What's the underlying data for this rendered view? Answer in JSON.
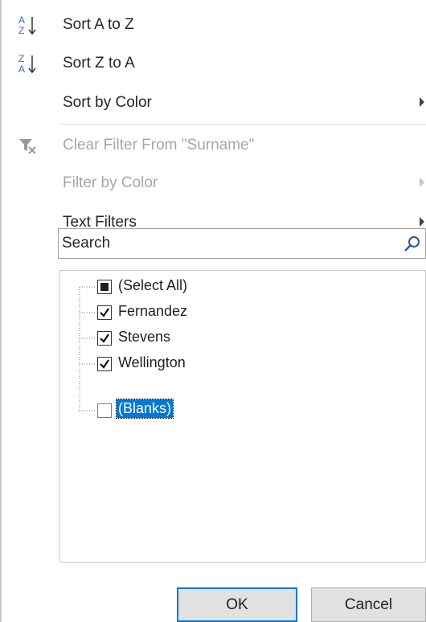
{
  "menu": {
    "sort_az": {
      "label": "Sort A to Z",
      "icon": "sort-az-icon"
    },
    "sort_za": {
      "label": "Sort Z to A",
      "icon": "sort-za-icon"
    },
    "sort_by_color": {
      "label": "Sort by Color"
    },
    "clear_filter": {
      "label": "Clear Filter From \"Surname\"",
      "icon": "clear-filter-icon"
    },
    "filter_by_color": {
      "label": "Filter by Color"
    },
    "text_filters": {
      "label": "Text Filters"
    }
  },
  "search": {
    "placeholder": "Search",
    "value": ""
  },
  "values_list": [
    {
      "label": "(Select All)",
      "state": "partial"
    },
    {
      "label": "Fernandez",
      "state": "checked"
    },
    {
      "label": "Stevens",
      "state": "checked"
    },
    {
      "label": "Wellington",
      "state": "checked"
    },
    {
      "label": "(Blanks)",
      "state": "unchecked"
    }
  ],
  "buttons": {
    "ok": "OK",
    "cancel": "Cancel"
  },
  "colors": {
    "accent": "#0078d7",
    "sort_icon_blue": "#2f6fc8",
    "sort_icon_purple": "#7b4fa8",
    "disabled_text": "#a6a6a6"
  }
}
